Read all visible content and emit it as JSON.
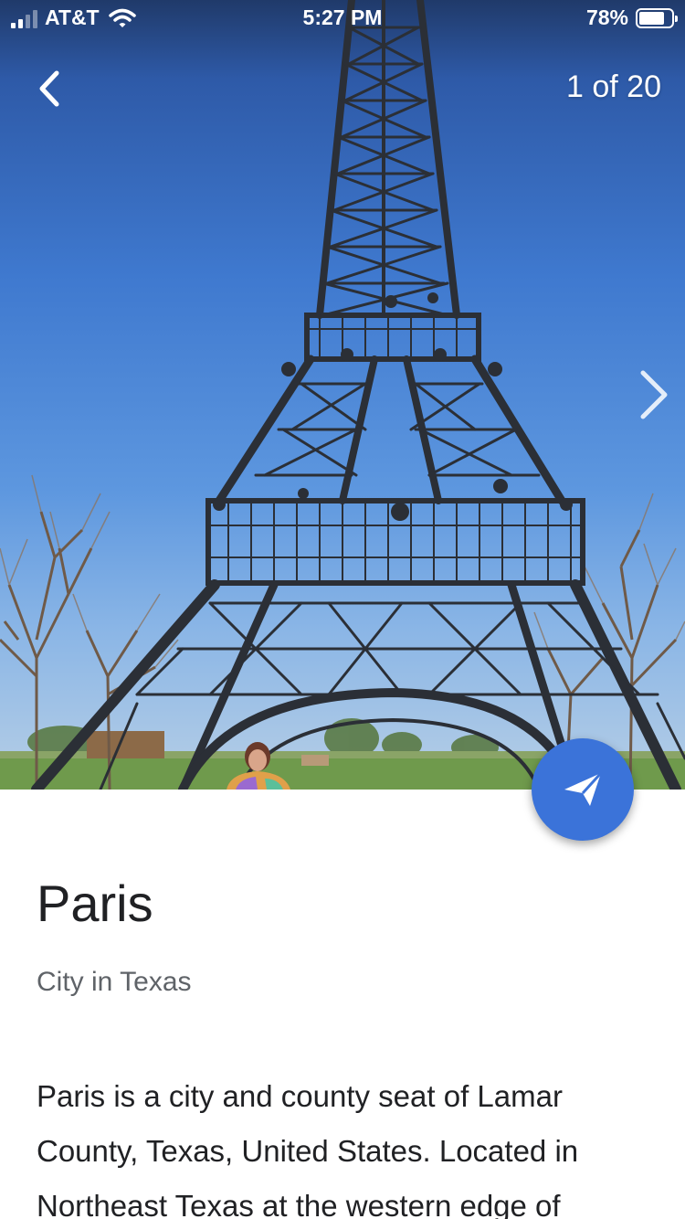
{
  "status_bar": {
    "carrier": "AT&T",
    "time": "5:27 PM",
    "battery_percent_label": "78%",
    "battery_level": 0.78,
    "signal_bars": 2,
    "signal_bars_total": 4
  },
  "photo_viewer": {
    "counter": "1 of 20",
    "back_icon": "chevron-left-icon",
    "next_icon": "chevron-right-icon"
  },
  "directions_fab": {
    "icon": "paper-plane-icon",
    "color": "#3b73d9"
  },
  "place": {
    "title": "Paris",
    "subtitle": "City in Texas",
    "description": "Paris is a city and county seat of Lamar County, Texas, United States. Located in Northeast Texas at the western edge of"
  }
}
